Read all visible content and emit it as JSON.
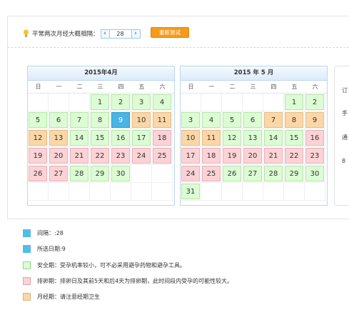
{
  "control": {
    "label": "平常两次月经大概相隔：",
    "interval_value": "28",
    "prev_symbol": "‹",
    "next_symbol": "›",
    "retest_label": "重新测试"
  },
  "weekday_headers": [
    "日",
    "一",
    "二",
    "三",
    "四",
    "五",
    "六"
  ],
  "calendars": [
    {
      "title": "2015年4月",
      "cells": [
        {
          "t": "empty"
        },
        {
          "t": "empty"
        },
        {
          "t": "empty"
        },
        {
          "d": "1",
          "t": "safe"
        },
        {
          "d": "2",
          "t": "safe"
        },
        {
          "d": "3",
          "t": "safe"
        },
        {
          "d": "4",
          "t": "safe"
        },
        {
          "d": "5",
          "t": "safe"
        },
        {
          "d": "6",
          "t": "safe"
        },
        {
          "d": "7",
          "t": "safe"
        },
        {
          "d": "8",
          "t": "safe"
        },
        {
          "d": "9",
          "t": "sel"
        },
        {
          "d": "10",
          "t": "per"
        },
        {
          "d": "11",
          "t": "per"
        },
        {
          "d": "12",
          "t": "per"
        },
        {
          "d": "13",
          "t": "per"
        },
        {
          "d": "14",
          "t": "safe"
        },
        {
          "d": "15",
          "t": "safe"
        },
        {
          "d": "16",
          "t": "safe"
        },
        {
          "d": "17",
          "t": "safe"
        },
        {
          "d": "18",
          "t": "ov"
        },
        {
          "d": "19",
          "t": "ov"
        },
        {
          "d": "20",
          "t": "ov"
        },
        {
          "d": "21",
          "t": "ov"
        },
        {
          "d": "22",
          "t": "ov"
        },
        {
          "d": "23",
          "t": "ov"
        },
        {
          "d": "24",
          "t": "ov"
        },
        {
          "d": "25",
          "t": "ov"
        },
        {
          "d": "26",
          "t": "ov"
        },
        {
          "d": "27",
          "t": "ov"
        },
        {
          "d": "28",
          "t": "safe"
        },
        {
          "d": "29",
          "t": "safe"
        },
        {
          "d": "30",
          "t": "safe"
        },
        {
          "t": "empty"
        },
        {
          "t": "empty"
        },
        {
          "t": "empty"
        },
        {
          "t": "empty"
        },
        {
          "t": "empty"
        },
        {
          "t": "empty"
        },
        {
          "t": "empty"
        },
        {
          "t": "empty"
        },
        {
          "t": "empty"
        }
      ]
    },
    {
      "title": "2015 年 5 月",
      "cells": [
        {
          "t": "empty"
        },
        {
          "t": "empty"
        },
        {
          "t": "empty"
        },
        {
          "t": "empty"
        },
        {
          "t": "empty"
        },
        {
          "d": "1",
          "t": "safe"
        },
        {
          "d": "2",
          "t": "safe"
        },
        {
          "d": "3",
          "t": "safe"
        },
        {
          "d": "4",
          "t": "safe"
        },
        {
          "d": "5",
          "t": "safe"
        },
        {
          "d": "6",
          "t": "safe"
        },
        {
          "d": "7",
          "t": "per"
        },
        {
          "d": "8",
          "t": "per"
        },
        {
          "d": "9",
          "t": "per"
        },
        {
          "d": "10",
          "t": "per"
        },
        {
          "d": "11",
          "t": "per"
        },
        {
          "d": "12",
          "t": "safe"
        },
        {
          "d": "13",
          "t": "safe"
        },
        {
          "d": "14",
          "t": "safe"
        },
        {
          "d": "15",
          "t": "safe"
        },
        {
          "d": "16",
          "t": "ov"
        },
        {
          "d": "17",
          "t": "ov"
        },
        {
          "d": "18",
          "t": "ov"
        },
        {
          "d": "19",
          "t": "ov"
        },
        {
          "d": "20",
          "t": "ov"
        },
        {
          "d": "21",
          "t": "ov"
        },
        {
          "d": "22",
          "t": "ov"
        },
        {
          "d": "23",
          "t": "ov"
        },
        {
          "d": "24",
          "t": "ov"
        },
        {
          "d": "25",
          "t": "ov"
        },
        {
          "d": "26",
          "t": "safe"
        },
        {
          "d": "27",
          "t": "safe"
        },
        {
          "d": "28",
          "t": "safe"
        },
        {
          "d": "29",
          "t": "safe"
        },
        {
          "d": "30",
          "t": "safe"
        },
        {
          "d": "31",
          "t": "safe"
        },
        {
          "t": "empty"
        },
        {
          "t": "empty"
        },
        {
          "t": "empty"
        },
        {
          "t": "empty"
        },
        {
          "t": "empty"
        },
        {
          "t": "empty"
        }
      ]
    }
  ],
  "side_panel": {
    "labels": [
      "订",
      "手",
      "通",
      "8"
    ]
  },
  "legend": [
    {
      "swatch": "blue",
      "text": "间隔：:28"
    },
    {
      "swatch": "blue",
      "text": "所选日期:9"
    },
    {
      "swatch": "safe",
      "text": "安全期：受孕机率较小，可不必采用避孕药物和避孕工具。"
    },
    {
      "swatch": "ov",
      "text": "排卵期：排卵日及其前5天和后4天为排卵期，此时间段内受孕的可能性较大。"
    },
    {
      "swatch": "per",
      "text": "月经期：请注意经期卫生"
    }
  ],
  "colors": {
    "safe": "#dcfcd4",
    "ovulation": "#fbd3d6",
    "period": "#fbd7a7",
    "selected": "#4ab4e4",
    "retest_button": "#f59a1a"
  }
}
